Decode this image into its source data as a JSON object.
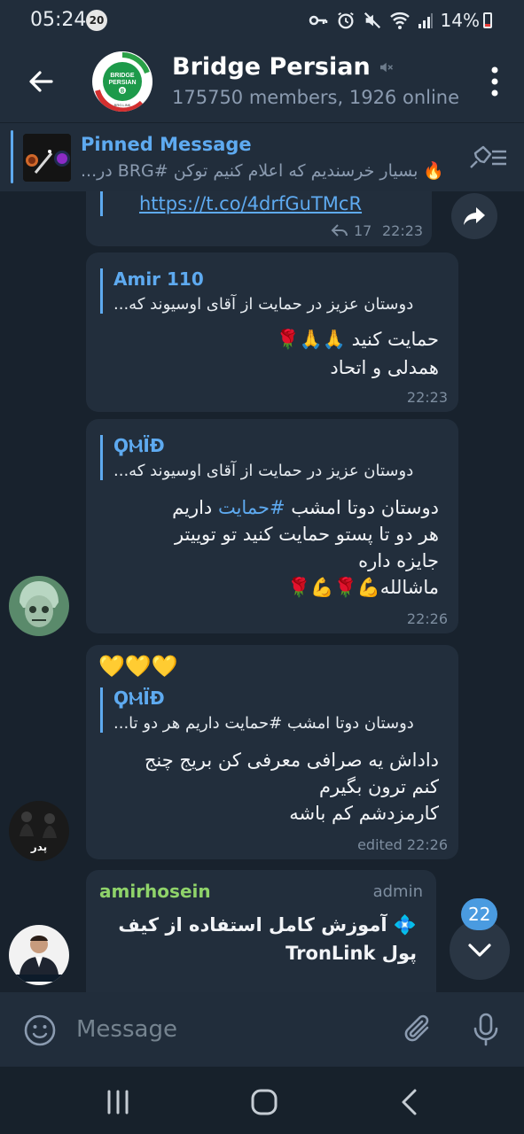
{
  "status_bar": {
    "time": "05:24",
    "notification_count": "20",
    "battery": "14%"
  },
  "header": {
    "title": "Bridge Persian",
    "subtitle": "175750 members, 1926 online",
    "avatar_lines": [
      "BRIDGE",
      "PERSIAN",
      "B",
      "BRG.LINK"
    ]
  },
  "pinned": {
    "title": "Pinned Message",
    "text": "🔥 بسیار خرسندیم که اعلام کنیم توکن #BRG در..."
  },
  "messages": [
    {
      "link": "https://t.co/4drfGuTMcR",
      "shares": "17",
      "time": "22:23"
    },
    {
      "reply_name": "Amir 110",
      "reply_text": "دوستان عزیز  در حمایت از آقای اوسیوند که...",
      "lines": [
        "حمایت کنید 🙏🙏🌹",
        "همدلی و اتحاد"
      ],
      "time": "22:23"
    },
    {
      "reply_name": "ϘⲘЇĐ",
      "reply_text": "دوستان عزیز  در حمایت از آقای اوسیوند که...",
      "line1_before": "دوستان دوتا امشب ",
      "line1_hashtag": "#حمایت",
      "line1_after": " داریم",
      "lines": [
        "هر دو تا پستو حمایت کنید تو توییتر",
        "جایزه داره",
        "ماشالله💪🌹💪🌹"
      ],
      "time": "22:26"
    },
    {
      "emojis": "💛💛💛",
      "reply_name": "ϘⲘЇĐ",
      "reply_text": "دوستان دوتا امشب #حمایت داریم  هر دو تا...",
      "lines": [
        "داداش یه صرافی معرفی کن بریج چنج",
        "کنم ترون بگیرم",
        "کارمزدشم کم باشه"
      ],
      "time": "edited 22:26"
    },
    {
      "sender": "amirhosein",
      "role": "admin",
      "lines": [
        "💠 آموزش کامل استفاده از کیف",
        "پول TronLink"
      ]
    }
  ],
  "avatar_captions": {
    "father": "پدر"
  },
  "unread_count": "22",
  "input": {
    "placeholder": "Message"
  },
  "colors": {
    "accent": "#5eaaf0",
    "sender_green": "#8fd36a",
    "background": "#18222d",
    "bubble": "#222e3c"
  }
}
